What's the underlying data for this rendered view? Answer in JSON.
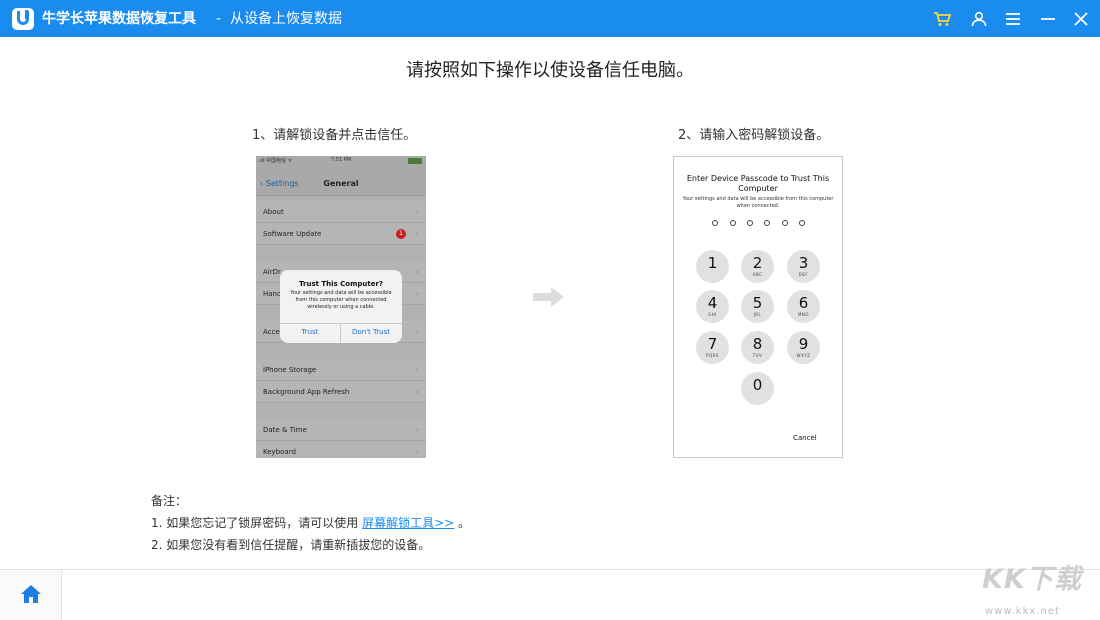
{
  "titlebar": {
    "app_name": "牛学长苹果数据恢复工具",
    "separator": "-",
    "subtitle": "从设备上恢复数据",
    "bg_color": "#1a8cf0",
    "icons": [
      "cart-icon",
      "user-icon",
      "menu-icon",
      "minimize-icon",
      "close-icon"
    ]
  },
  "main": {
    "heading": "请按照如下操作以使设备信任电脑。",
    "step1_label": "1、请解锁设备并点击信任。",
    "step2_label": "2、请输入密码解锁设备。"
  },
  "phone1": {
    "status_carrier": "ııll 中国电信 ᯤ",
    "status_time": "7:51 PM",
    "back_label": "Settings",
    "nav_title": "General",
    "rows": [
      "About",
      "Software Update",
      "AirDr",
      "Hand",
      "Acce",
      "iPhone Storage",
      "Background App Refresh",
      "Date & Time",
      "Keyboard"
    ],
    "badge_count": "1",
    "alert_title": "Trust This Computer?",
    "alert_body": "Your settings and data will be accessible from this computer when connected wirelessly or using a cable.",
    "trust_label": "Trust",
    "dont_trust_label": "Don't Trust"
  },
  "phone2": {
    "title": "Enter Device Passcode to Trust This Computer",
    "subtitle": "Your settings and data will be accessible from this computer when connected.",
    "keys": [
      {
        "digit": "1",
        "letters": ""
      },
      {
        "digit": "2",
        "letters": "ABC"
      },
      {
        "digit": "3",
        "letters": "DEF"
      },
      {
        "digit": "4",
        "letters": "GHI"
      },
      {
        "digit": "5",
        "letters": "JKL"
      },
      {
        "digit": "6",
        "letters": "MNO"
      },
      {
        "digit": "7",
        "letters": "PQRS"
      },
      {
        "digit": "8",
        "letters": "TUV"
      },
      {
        "digit": "9",
        "letters": "WXYZ"
      },
      {
        "digit": "0",
        "letters": ""
      }
    ],
    "cancel_label": "Cancel"
  },
  "notes": {
    "header": "备注：",
    "note1_prefix": "1. 如果您忘记了锁屏密码，请可以使用 ",
    "note1_link": "屏幕解锁工具>>",
    "note1_suffix": " 。",
    "note2": "2. 如果您没有看到信任提醒，请重新插拔您的设备。"
  },
  "footer": {
    "home_icon": "home-icon"
  },
  "watermark": {
    "big": "KK下载",
    "small": "www.kkx.net"
  }
}
